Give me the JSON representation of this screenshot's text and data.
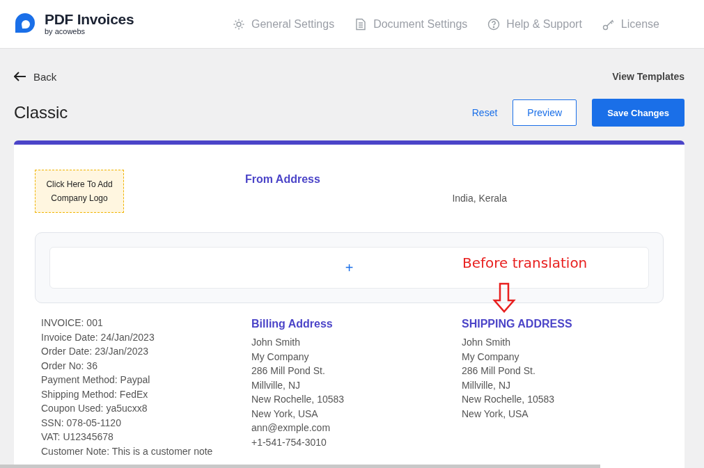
{
  "header": {
    "brand": {
      "title": "PDF Invoices",
      "subtitle": "by acowebs"
    },
    "nav": [
      {
        "label": "General Settings"
      },
      {
        "label": "Document Settings"
      },
      {
        "label": "Help & Support"
      },
      {
        "label": "License"
      }
    ]
  },
  "toolbar": {
    "back": "Back",
    "view_templates": "View Templates",
    "title": "Classic",
    "reset": "Reset",
    "preview": "Preview",
    "save": "Save Changes"
  },
  "invoice": {
    "logo_placeholder": "Click Here To Add Company Logo",
    "from_title": "From Address",
    "from_lines": [
      "India, Kerala"
    ],
    "header_add": "+",
    "details": [
      "INVOICE: 001",
      "Invoice Date: 24/Jan/2023",
      "Order Date: 23/Jan/2023",
      "Order No: 36",
      "Payment Method: Paypal",
      "Shipping Method: FedEx",
      "Coupon Used: ya5ucxx8",
      "SSN: 078-05-1120",
      "VAT: U12345678",
      "Customer Note: This is a customer note"
    ],
    "billing": {
      "title": "Billing Address",
      "lines": [
        "John Smith",
        "My Company",
        "286 Mill Pond St.",
        "Millville, NJ",
        "New Rochelle, 10583",
        "New York, USA",
        "ann@exmple.com",
        "+1-541-754-3010"
      ]
    },
    "shipping": {
      "title": "SHIPPING ADDRESS",
      "lines": [
        "John Smith",
        "My Company",
        "286 Mill Pond St.",
        "Millville, NJ",
        "New Rochelle, 10583",
        "New York, USA"
      ]
    }
  },
  "annotation": {
    "text": "Before translation"
  }
}
